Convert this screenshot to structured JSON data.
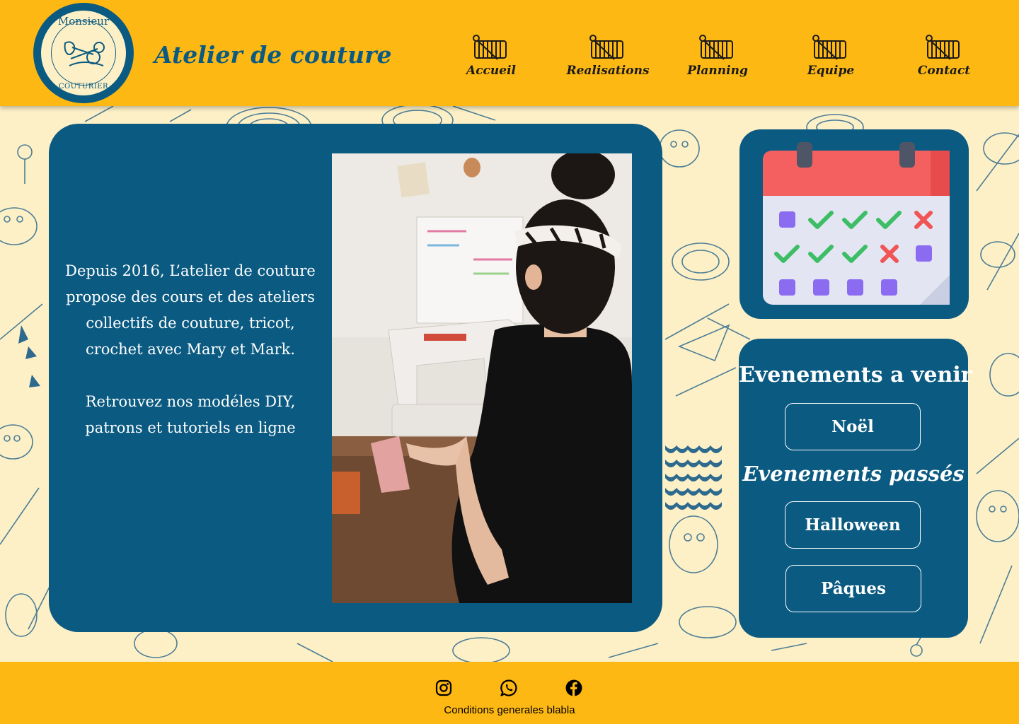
{
  "header": {
    "logo_top_text": "Monsieur",
    "logo_bottom_text": "COUTURIER",
    "site_title": "Atelier de couture",
    "nav": [
      {
        "label": "Accueil",
        "icon": "thread-spool-icon"
      },
      {
        "label": "Realisations",
        "icon": "thread-spool-icon"
      },
      {
        "label": "Planning",
        "icon": "thread-spool-icon"
      },
      {
        "label": "Equipe",
        "icon": "thread-spool-icon"
      },
      {
        "label": "Contact",
        "icon": "thread-spool-icon"
      }
    ]
  },
  "main": {
    "intro_paragraph_1": "Depuis 2016, L’atelier de couture propose des cours et des ateliers collectifs de couture, tricot, crochet avec Mary et Mark.",
    "intro_paragraph_2": "Retrouvez nos modéles DIY, patrons et tutoriels en ligne"
  },
  "calendar": {
    "icon": "calendar-icon"
  },
  "events": {
    "upcoming_heading": "Evenements a venir",
    "upcoming": [
      "Noël"
    ],
    "past_heading": "Evenements passés",
    "past": [
      "Halloween",
      "Pâques"
    ]
  },
  "footer": {
    "social": [
      "instagram-icon",
      "whatsapp-icon",
      "facebook-icon"
    ],
    "terms_text": "Conditions generales blabla"
  },
  "colors": {
    "header_bg": "#FDB813",
    "page_bg": "#FDF0C6",
    "card_bg": "#0B5A81",
    "pattern_line": "#2E6A8E"
  }
}
